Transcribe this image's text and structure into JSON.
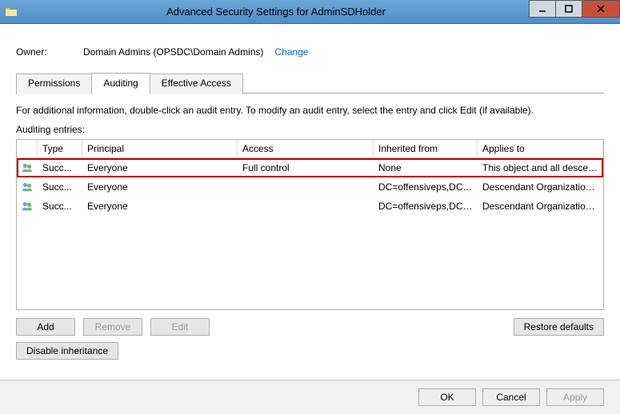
{
  "window": {
    "title": "Advanced Security Settings for AdminSDHolder"
  },
  "owner": {
    "label": "Owner:",
    "value": "Domain Admins (OPSDC\\Domain Admins)",
    "change": "Change"
  },
  "tabs": {
    "permissions": "Permissions",
    "auditing": "Auditing",
    "effective": "Effective Access"
  },
  "info_text": "For additional information, double-click an audit entry. To modify an audit entry, select the entry and click Edit (if available).",
  "entries_label": "Auditing entries:",
  "columns": {
    "type": "Type",
    "principal": "Principal",
    "access": "Access",
    "inherited": "Inherited from",
    "applies": "Applies to"
  },
  "rows": [
    {
      "type": "Succ...",
      "principal": "Everyone",
      "access": "Full control",
      "inherited": "None",
      "applies": "This object and all descendant...",
      "highlight": true
    },
    {
      "type": "Succ...",
      "principal": "Everyone",
      "access": "",
      "inherited": "DC=offensiveps,DC=c...",
      "applies": "Descendant Organizational Un...",
      "highlight": false
    },
    {
      "type": "Succ...",
      "principal": "Everyone",
      "access": "",
      "inherited": "DC=offensiveps,DC=c...",
      "applies": "Descendant Organizational Un...",
      "highlight": false
    }
  ],
  "buttons": {
    "add": "Add",
    "remove": "Remove",
    "edit": "Edit",
    "restore": "Restore defaults",
    "disable_inh": "Disable inheritance",
    "ok": "OK",
    "cancel": "Cancel",
    "apply": "Apply"
  }
}
